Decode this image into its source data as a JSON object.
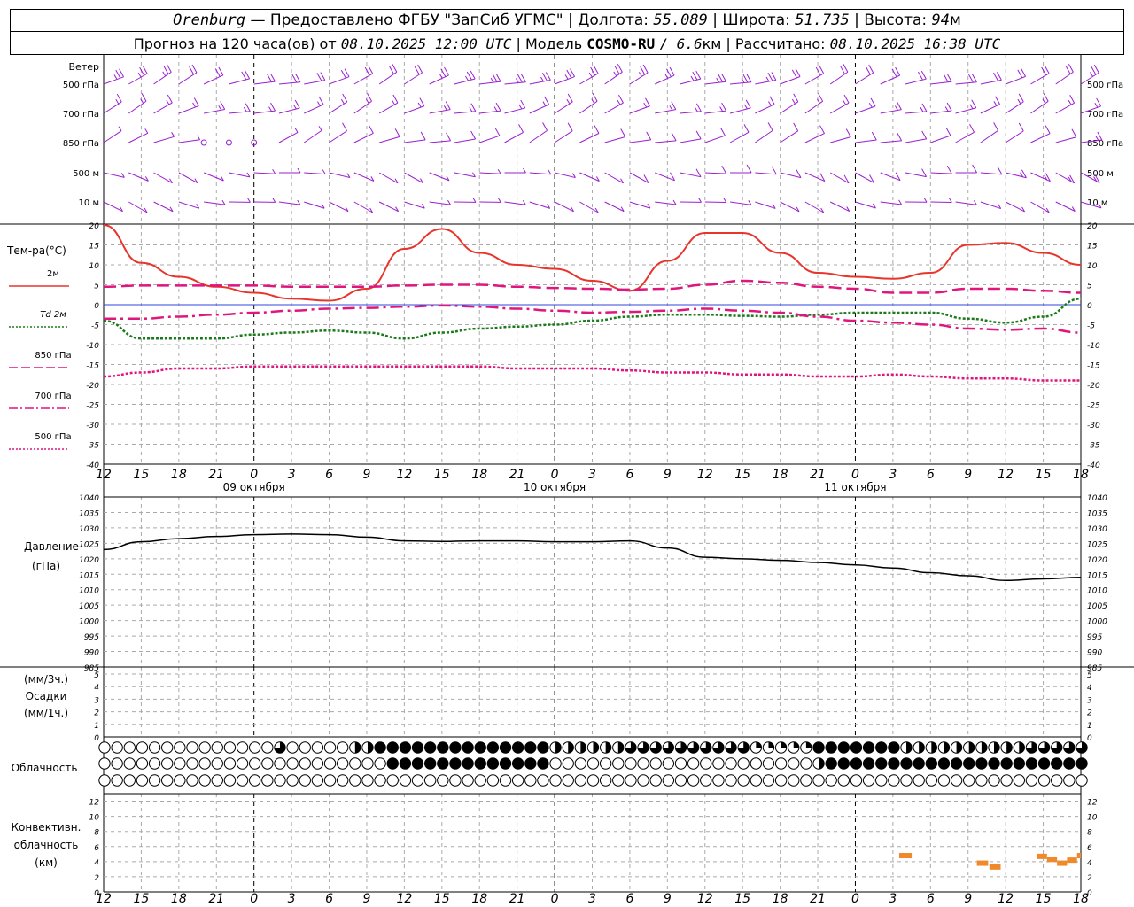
{
  "header": {
    "line1": {
      "station": "Orenburg",
      "provided": "— Предоставлено ФГБУ \"ЗапСиб УГМС\"",
      "lon_label": "Долгота:",
      "lon_value": "55.089",
      "lat_label": "Широта:",
      "lat_value": "51.735",
      "alt_label": "Высота:",
      "alt_value": "94",
      "alt_unit": "м"
    },
    "line2": {
      "forecast": "Прогноз на 120 часа(ов) от",
      "forecast_time": "08.10.2025 12:00 UTC",
      "model_label": "| Модель",
      "model_name": "COSMO-RU",
      "model_res": "/ 6.6",
      "model_res_unit": "км",
      "calc_label": "| Рассчитано:",
      "calc_time": "08.10.2025 16:38 UTC"
    }
  },
  "wind_panel": {
    "title": "Ветер",
    "levels": [
      "500 гПа",
      "700 гПа",
      "850 гПа",
      "500 м",
      "10 м"
    ],
    "color": "#9a1fd0"
  },
  "temp_panel": {
    "title": "Тем-ра(°C)",
    "legend": [
      {
        "label": "2м",
        "color": "#e8352c",
        "dash": "solid"
      },
      {
        "label": "Td 2м",
        "color": "#1b7a1b",
        "dash": "dot"
      },
      {
        "label": "850 гПа",
        "color": "#e0167f",
        "dash": "long"
      },
      {
        "label": "700 гПа",
        "color": "#e0167f",
        "dash": "dashdot"
      },
      {
        "label": "500 гПа",
        "color": "#e0167f",
        "dash": "dot"
      }
    ],
    "y_ticks": [
      20,
      15,
      10,
      5,
      0,
      -5,
      -10,
      -15,
      -20,
      -25,
      -30,
      -35,
      -40
    ]
  },
  "x_axis": {
    "hour_labels": [
      "12",
      "15",
      "18",
      "21",
      "0",
      "3",
      "6",
      "9",
      "12",
      "15",
      "18",
      "21",
      "0",
      "3",
      "6",
      "9",
      "12",
      "15",
      "18",
      "21",
      "0",
      "3",
      "6",
      "9",
      "12",
      "15",
      "18"
    ],
    "date_labels": [
      "09 октября",
      "10 октября",
      "11 октября"
    ]
  },
  "pressure_panel": {
    "title": "Давление",
    "unit": "(гПа)",
    "y_ticks": [
      1040,
      1035,
      1030,
      1025,
      1020,
      1015,
      1010,
      1005,
      1000,
      995,
      990,
      985
    ]
  },
  "precip_panel": {
    "unit3": "(мм/3ч.)",
    "title": "Осадки",
    "unit1": "(мм/1ч.)",
    "y_ticks": [
      5,
      4,
      3,
      2,
      1,
      0
    ]
  },
  "cloud_panel": {
    "title": "Облачность"
  },
  "conv_panel": {
    "title": "Конвективн.",
    "title2": "облачность",
    "unit": "(км)",
    "y_ticks": [
      12,
      10,
      8,
      6,
      4,
      2,
      0
    ],
    "color": "#f0892b"
  },
  "chart_data": {
    "type": "line",
    "x_unit": "hours from 08.10.2025 12:00 UTC",
    "x_range": [
      0,
      78
    ],
    "temperature": {
      "ylim": [
        -40,
        20
      ],
      "series": [
        {
          "name": "2м",
          "x": [
            0,
            3,
            6,
            9,
            12,
            15,
            18,
            21,
            24,
            27,
            30,
            33,
            36,
            39,
            42,
            45,
            48,
            51,
            54,
            57,
            60,
            63,
            66,
            69,
            72,
            75,
            78
          ],
          "values": [
            20,
            10.5,
            7,
            4.5,
            3,
            1.5,
            1,
            4,
            14,
            19,
            13,
            10,
            9,
            6,
            3.5,
            11,
            18,
            18,
            13,
            8,
            7,
            6.5,
            8,
            15,
            15.5,
            13,
            10
          ]
        },
        {
          "name": "Td 2м",
          "x": [
            0,
            3,
            6,
            9,
            12,
            15,
            18,
            21,
            24,
            27,
            30,
            33,
            36,
            39,
            42,
            45,
            48,
            51,
            54,
            57,
            60,
            63,
            66,
            69,
            72,
            75,
            78
          ],
          "values": [
            -4,
            -8.5,
            -8.5,
            -8.5,
            -7.5,
            -7,
            -6.5,
            -7,
            -8.5,
            -7,
            -6,
            -5.5,
            -5,
            -4,
            -3,
            -2.5,
            -2.5,
            -2.8,
            -3,
            -2.5,
            -2,
            -2,
            -2,
            -3.5,
            -4.5,
            -3,
            1.5
          ]
        },
        {
          "name": "850 гПа",
          "x": [
            0,
            3,
            6,
            9,
            12,
            15,
            18,
            21,
            24,
            27,
            30,
            33,
            36,
            39,
            42,
            45,
            48,
            51,
            54,
            57,
            60,
            63,
            66,
            69,
            72,
            75,
            78
          ],
          "values": [
            4.5,
            4.8,
            4.8,
            4.8,
            4.8,
            4.5,
            4.5,
            4.5,
            4.8,
            5,
            5,
            4.5,
            4.2,
            4,
            3.8,
            4,
            5,
            6,
            5.5,
            4.5,
            4,
            3,
            3,
            4,
            4,
            3.5,
            3
          ]
        },
        {
          "name": "700 гПа",
          "x": [
            0,
            3,
            6,
            9,
            12,
            15,
            18,
            21,
            24,
            27,
            30,
            33,
            36,
            39,
            42,
            45,
            48,
            51,
            54,
            57,
            60,
            63,
            66,
            69,
            72,
            75,
            78
          ],
          "values": [
            -3.5,
            -3.5,
            -3,
            -2.5,
            -2,
            -1.5,
            -1,
            -0.8,
            -0.5,
            -0.2,
            -0.5,
            -1,
            -1.5,
            -2,
            -1.8,
            -1.5,
            -1,
            -1.5,
            -2,
            -3,
            -4,
            -4.5,
            -5,
            -6,
            -6.3,
            -6,
            -7
          ]
        },
        {
          "name": "500 гПа",
          "x": [
            0,
            3,
            6,
            9,
            12,
            15,
            18,
            21,
            24,
            27,
            30,
            33,
            36,
            39,
            42,
            45,
            48,
            51,
            54,
            57,
            60,
            63,
            66,
            69,
            72,
            75,
            78
          ],
          "values": [
            -18,
            -17,
            -16,
            -16,
            -15.5,
            -15.5,
            -15.5,
            -15.5,
            -15.5,
            -15.5,
            -15.5,
            -16,
            -16,
            -16,
            -16.5,
            -17,
            -17,
            -17.5,
            -17.5,
            -18,
            -18,
            -17.5,
            -18,
            -18.5,
            -18.5,
            -19,
            -19
          ]
        }
      ]
    },
    "pressure": {
      "ylim": [
        985,
        1040
      ],
      "series": [
        {
          "name": "Давление",
          "x": [
            0,
            3,
            6,
            9,
            12,
            15,
            18,
            21,
            24,
            27,
            30,
            33,
            36,
            39,
            42,
            45,
            48,
            51,
            54,
            57,
            60,
            63,
            66,
            69,
            72,
            75,
            78
          ],
          "values": [
            1023,
            1025.5,
            1026.5,
            1027.2,
            1027.8,
            1028,
            1027.8,
            1027,
            1025.8,
            1025.6,
            1025.8,
            1025.8,
            1025.5,
            1025.5,
            1025.8,
            1023.5,
            1020.5,
            1020,
            1019.5,
            1018.8,
            1018,
            1017,
            1015.5,
            1014.5,
            1013,
            1013.5,
            1014
          ]
        }
      ]
    },
    "precipitation": {
      "ylim": [
        0,
        5
      ],
      "values": []
    },
    "convective_cloud": {
      "ylim": [
        0,
        13
      ],
      "segments": [
        {
          "x": [
            63.5,
            64.5
          ],
          "km": 4.8
        },
        {
          "x": [
            69.7,
            70.6
          ],
          "km": 3.8
        },
        {
          "x": [
            70.7,
            71.6
          ],
          "km": 3.3
        },
        {
          "x": [
            74.5,
            75.3
          ],
          "km": 4.7
        },
        {
          "x": [
            75.3,
            76.1
          ],
          "km": 4.3
        },
        {
          "x": [
            76.1,
            76.9
          ],
          "km": 3.8
        },
        {
          "x": [
            76.9,
            77.7
          ],
          "km": 4.2
        },
        {
          "x": [
            77.7,
            78.0
          ],
          "km": 4.8
        }
      ]
    },
    "cloud_cover": {
      "step_hours": 1,
      "rows": [
        {
          "name": "high",
          "segments": [
            {
              "from": 0,
              "to": 14,
              "cover": 0
            },
            {
              "from": 14,
              "to": 15,
              "cover": 0.75
            },
            {
              "from": 15,
              "to": 20,
              "cover": 0
            },
            {
              "from": 20,
              "to": 22,
              "cover": 0.5
            },
            {
              "from": 22,
              "to": 36,
              "cover": 1
            },
            {
              "from": 36,
              "to": 42,
              "cover": 0.5
            },
            {
              "from": 42,
              "to": 52,
              "cover": 0.75
            },
            {
              "from": 52,
              "to": 57,
              "cover": 0.25
            },
            {
              "from": 57,
              "to": 64,
              "cover": 1
            },
            {
              "from": 64,
              "to": 74,
              "cover": 0.5
            },
            {
              "from": 74,
              "to": 79,
              "cover": 0.75
            }
          ]
        },
        {
          "name": "middle",
          "segments": [
            {
              "from": 0,
              "to": 23,
              "cover": 0
            },
            {
              "from": 23,
              "to": 36,
              "cover": 1
            },
            {
              "from": 36,
              "to": 57,
              "cover": 0
            },
            {
              "from": 57,
              "to": 58,
              "cover": 0.5
            },
            {
              "from": 58,
              "to": 79,
              "cover": 1
            }
          ]
        },
        {
          "name": "low",
          "segments": [
            {
              "from": 0,
              "to": 79,
              "cover": 0
            }
          ]
        }
      ]
    },
    "wind_barbs": {
      "speeds_ms_by_level": {
        "500 гПа": [
          25,
          25,
          20,
          20,
          20,
          20,
          20,
          20,
          20,
          25,
          25,
          25,
          25,
          25,
          25,
          25,
          25,
          25,
          20,
          20,
          20,
          20,
          20,
          20,
          20,
          20,
          25
        ],
        "700 гПа": [
          15,
          15,
          15,
          15,
          15,
          15,
          15,
          15,
          15,
          15,
          15,
          15,
          15,
          15,
          15,
          15,
          15,
          15,
          15,
          15,
          15,
          15,
          15,
          15,
          15,
          15,
          15
        ],
        "850 гПа": [
          5,
          5,
          5,
          0,
          0,
          5,
          10,
          10,
          10,
          10,
          10,
          10,
          10,
          10,
          10,
          10,
          10,
          10,
          10,
          10,
          10,
          10,
          10,
          10,
          10,
          10,
          15
        ],
        "500 м": [
          5,
          5,
          5,
          5,
          5,
          5,
          5,
          5,
          5,
          5,
          5,
          5,
          5,
          5,
          10,
          10,
          10,
          10,
          10,
          10,
          10,
          10,
          10,
          10,
          15,
          15,
          15
        ],
        "10 м": [
          5,
          5,
          5,
          5,
          5,
          5,
          5,
          5,
          5,
          5,
          5,
          5,
          5,
          5,
          5,
          5,
          5,
          5,
          5,
          5,
          5,
          5,
          5,
          5,
          5,
          5,
          5
        ]
      }
    }
  }
}
